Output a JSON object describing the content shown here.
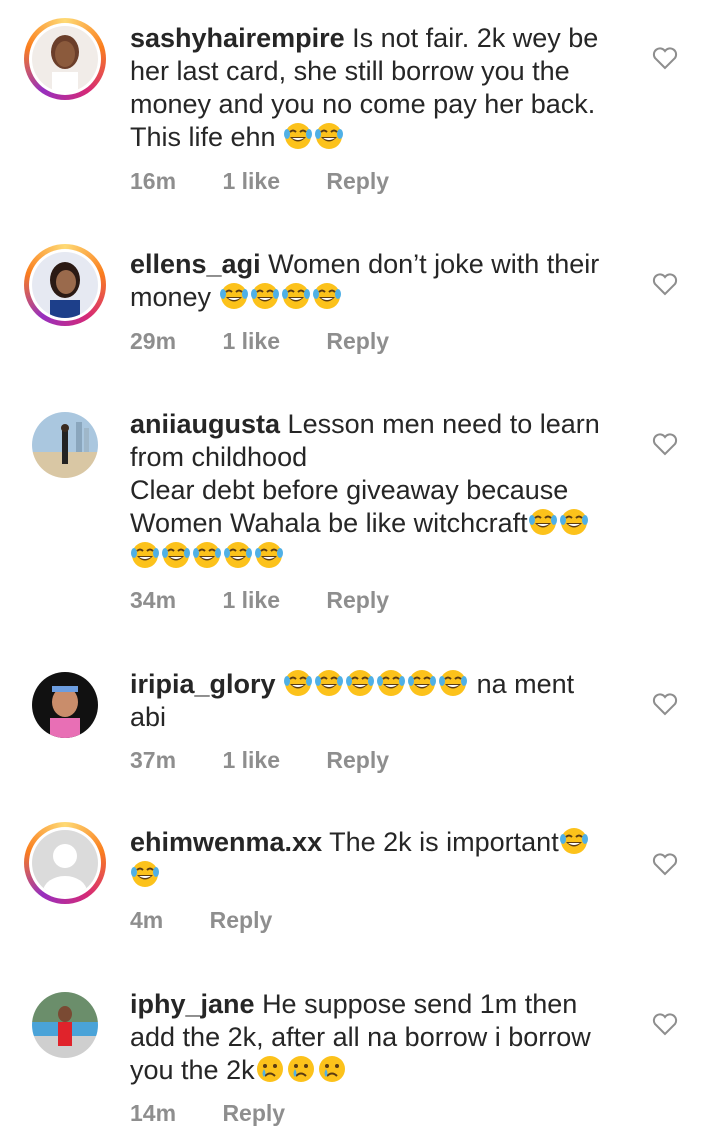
{
  "comments": [
    {
      "username": "sashyhairempire",
      "text_lines": [
        "Is not fair. 2k wey be",
        "her last card, she still borrow you the",
        "money and you no come pay her back.",
        "This life ehn"
      ],
      "trailing_emoji": "😂😂",
      "time": "16m",
      "likes": "1 like",
      "reply": "Reply"
    },
    {
      "username": "ellens_agi",
      "text_lines": [
        "Women don’t joke with their",
        "money"
      ],
      "trailing_emoji": "😂😂😂😂",
      "time": "29m",
      "likes": "1 like",
      "reply": "Reply"
    },
    {
      "username": "aniiaugusta",
      "text_lines": [
        "Lesson men need to learn",
        "from childhood",
        "Clear debt before giveaway because",
        "Women Wahala be like witchcraft"
      ],
      "trailing_emoji": "😂😂😂😂😂😂😂",
      "time": "34m",
      "likes": "1 like",
      "reply": "Reply"
    },
    {
      "username": "iripia_glory",
      "text_lines": [
        "",
        "na ment",
        "abi"
      ],
      "leading_emoji": "😂😂😂😂😂😂",
      "time": "37m",
      "likes": "1 like",
      "reply": "Reply"
    },
    {
      "username": "ehimwenma.xx",
      "text_lines": [
        "The 2k is important"
      ],
      "trailing_emoji": "😂😂",
      "time": "4m",
      "reply": "Reply"
    },
    {
      "username": "iphy_jane",
      "text_lines": [
        "He suppose send 1m then",
        "add the 2k, after all na borrow i borrow",
        "you the 2k"
      ],
      "trailing_emoji": "😢😢😢",
      "time": "14m",
      "reply": "Reply"
    }
  ],
  "icons": {
    "like": "heart-outline-icon",
    "laugh": "face-with-tears-of-joy-emoji",
    "cry": "crying-face-emoji"
  },
  "colors": {
    "meta": "#8e8e8e",
    "text": "#262626",
    "story_ring": "#d62976"
  }
}
